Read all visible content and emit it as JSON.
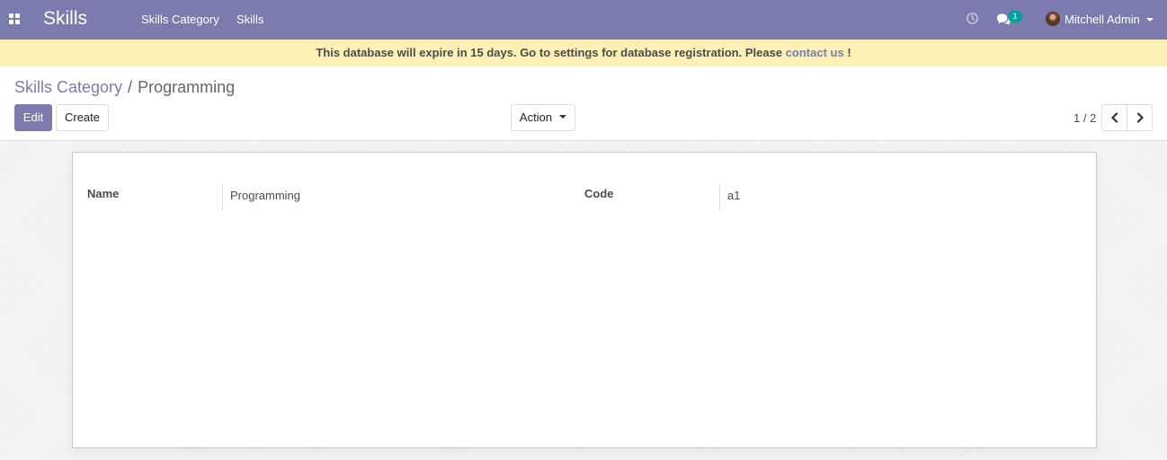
{
  "navbar": {
    "app_title": "Skills",
    "menu": [
      "Skills Category",
      "Skills"
    ],
    "chat_count": "1",
    "user_name": "Mitchell Admin",
    "color": "#7c7bad"
  },
  "banner": {
    "text": "This database will expire in 15 days. Go to settings for database registration. Please",
    "link": "contact us",
    "suffix": "!"
  },
  "breadcrumb": {
    "parent": "Skills Category",
    "separator": "/",
    "current": "Programming"
  },
  "toolbar": {
    "edit_label": "Edit",
    "create_label": "Create",
    "action_label": "Action"
  },
  "pager": {
    "value": "1 / 2"
  },
  "form": {
    "name_label": "Name",
    "name_value": "Programming",
    "code_label": "Code",
    "code_value": "a1"
  },
  "icons": {
    "apps": "apps-grid-icon",
    "clock": "clock-icon",
    "chat": "chat-bubbles-icon",
    "prev": "chevron-left-icon",
    "next": "chevron-right-icon"
  }
}
